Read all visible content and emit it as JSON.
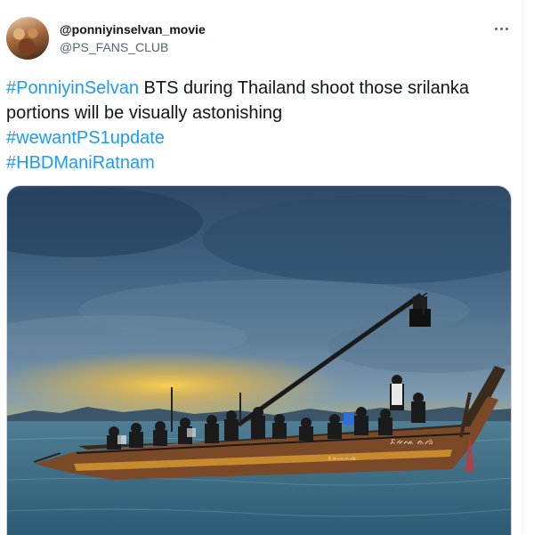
{
  "tweet": {
    "author": {
      "display_name": "@ponniyinselvan_movie",
      "handle": "@PS_FANS_CLUB"
    },
    "text_parts": [
      {
        "text": "#PonniyinSelvan",
        "hashtag": true
      },
      {
        "text": " BTS during Thailand shoot those srilanka portions will be visually astonishing ",
        "hashtag": false
      },
      {
        "text": "#wewantPS1update",
        "hashtag": true
      },
      {
        "text": "#HBDManiRatnam",
        "hashtag": true
      }
    ],
    "photo": {
      "boat_lettering_left": "ᨅᨀᨕᨊᨌ",
      "boat_lettering_right": "ᨅᨀᨕ ᨊᨌ"
    }
  },
  "colors": {
    "hashtag": "#1d9bf0",
    "text": "#0f1419",
    "secondary": "#536471"
  }
}
